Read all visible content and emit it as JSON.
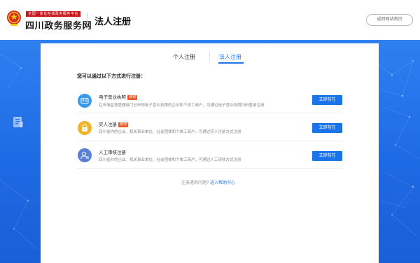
{
  "header": {
    "badge_text": "全国一体化在线政务服务平台",
    "site_name": "四川政务服务网",
    "page_title": "法人注册",
    "return_label": "返回网站首页"
  },
  "tabs": [
    {
      "label": "个人注册",
      "active": false
    },
    {
      "label": "法人注册",
      "active": true
    }
  ],
  "intro": "您可以通过以下方式进行注册：",
  "methods": [
    {
      "title": "电子营业执照",
      "badge": "推荐",
      "desc": "在市场监督管理部门已申领电子营业执照的企业和个体工商户，可通过电子营业执照扫码登录注册",
      "button": "立即前往",
      "icon": "id-card-icon",
      "icon_color": "#3a9ae8"
    },
    {
      "title": "实人注册",
      "badge": "推荐",
      "desc": "四川省内的企业、机关事业单位、社会团体和个体工商户，可通过实人注册方式注册",
      "button": "立即前往",
      "icon": "lock-icon",
      "icon_color": "#f2b228"
    },
    {
      "title": "人工审核注册",
      "badge": "",
      "desc": "四川省外的企业、机关事业单位、社会团体和个体工商户，可通过人工审核方式注册",
      "button": "立即前往",
      "icon": "user-review-icon",
      "icon_color": "#5a7fd6"
    }
  ],
  "help": {
    "text": "注册遇到问题?",
    "link": "进入帮助中心"
  },
  "colors": {
    "primary": "#1a73e8",
    "band": "#2a75ec",
    "badge_red": "#c8161d",
    "recommend": "#f05a28"
  }
}
